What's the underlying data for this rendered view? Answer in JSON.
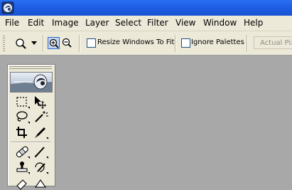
{
  "menu": {
    "items": [
      "File",
      "Edit",
      "Image",
      "Layer",
      "Select",
      "Filter",
      "View",
      "Window",
      "Help"
    ]
  },
  "options": {
    "tool": "zoom-tool",
    "resize_windows_label": "Resize Windows To Fit",
    "resize_windows_checked": false,
    "ignore_palettes_label": "Ignore Palettes",
    "ignore_palettes_checked": false,
    "actual_pixels_label": "Actual Pixels"
  },
  "toolbox": {
    "tools": [
      "marquee-tool",
      "move-tool",
      "lasso-tool",
      "magic-wand-tool",
      "crop-tool",
      "slice-tool",
      "healing-brush-tool",
      "brush-tool",
      "clone-stamp-tool",
      "history-brush-tool"
    ]
  },
  "colors": {
    "titlebar": "#1f5fe6",
    "menubar": "#ece9d8",
    "workspace": "#a8a8a8"
  }
}
